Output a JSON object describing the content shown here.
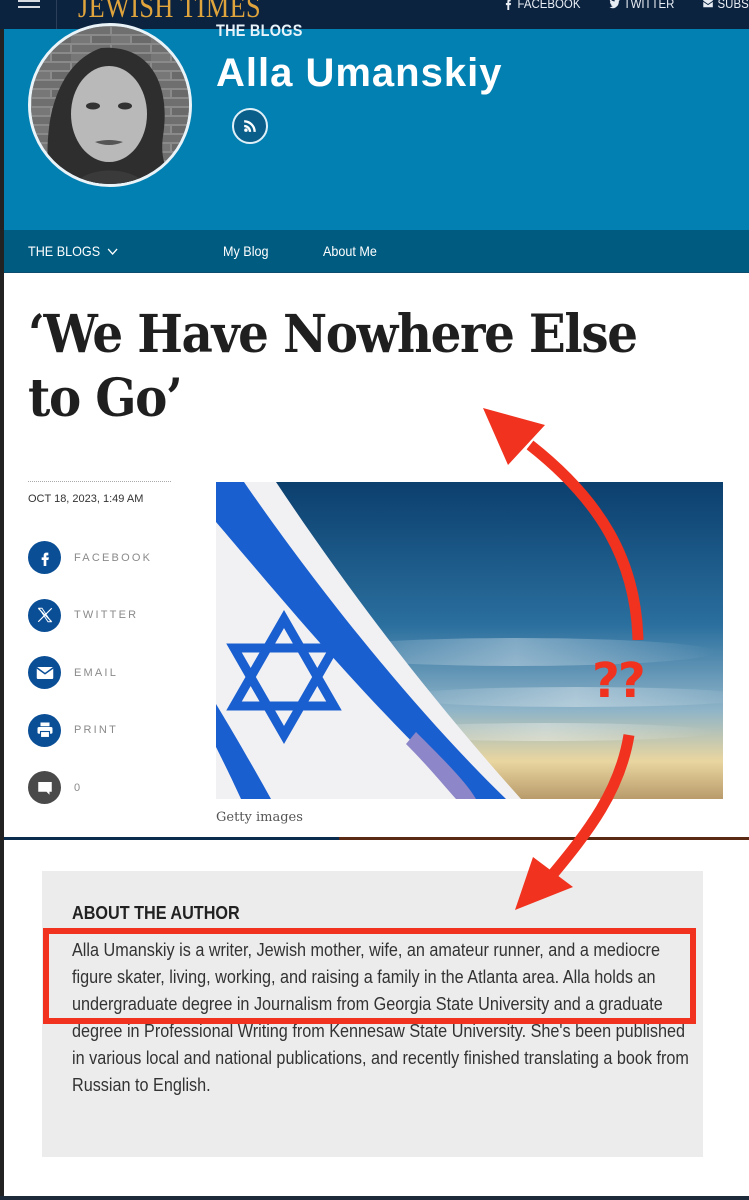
{
  "topbar": {
    "logo": "JEWISH TIMES",
    "links": [
      {
        "label": "FACEBOOK",
        "icon": "facebook-icon"
      },
      {
        "label": "TWITTER",
        "icon": "twitter-icon"
      },
      {
        "label": "SUBS",
        "icon": "mail-icon"
      }
    ]
  },
  "blog_header": {
    "kicker": "THE BLOGS",
    "author_name": "Alla Umanskiy",
    "rss_icon": "rss-icon"
  },
  "blog_nav": {
    "items": [
      {
        "label": "THE BLOGS",
        "has_dropdown": true
      },
      {
        "label": "My Blog"
      },
      {
        "label": "About Me"
      }
    ]
  },
  "article": {
    "headline": "‘We Have Nowhere Else to Go’",
    "date": "OCT 18, 2023, 1:49 AM",
    "share": [
      {
        "label": "FACEBOOK",
        "icon": "facebook-icon"
      },
      {
        "label": "TWITTER",
        "icon": "x-icon"
      },
      {
        "label": "EMAIL",
        "icon": "mail-icon"
      },
      {
        "label": "PRINT",
        "icon": "printer-icon"
      },
      {
        "label": "0",
        "icon": "comment-icon"
      }
    ],
    "image_caption": "Getty images",
    "image_description": "Israeli flag waving against a blue sunset sky"
  },
  "about": {
    "title": "ABOUT THE AUTHOR",
    "text": "Alla Umanskiy is a writer, Jewish mother, wife, an amateur runner, and a mediocre figure skater, living, working, and raising a family in the Atlanta area. Alla holds an undergraduate degree in Journalism from Georgia State University and a graduate degree in Professional Writing from Kennesaw State University. She's been published in various local and national publications, and recently finished translating a book from Russian to English."
  },
  "annotation": {
    "text": "??",
    "color": "#f0321e"
  },
  "colors": {
    "topbar": "#0c2340",
    "logo": "#e0a43c",
    "blog_header": "#0380b2",
    "blog_nav": "#005b80",
    "share_icon": "#0a4e96",
    "about_bg": "#ececec"
  }
}
